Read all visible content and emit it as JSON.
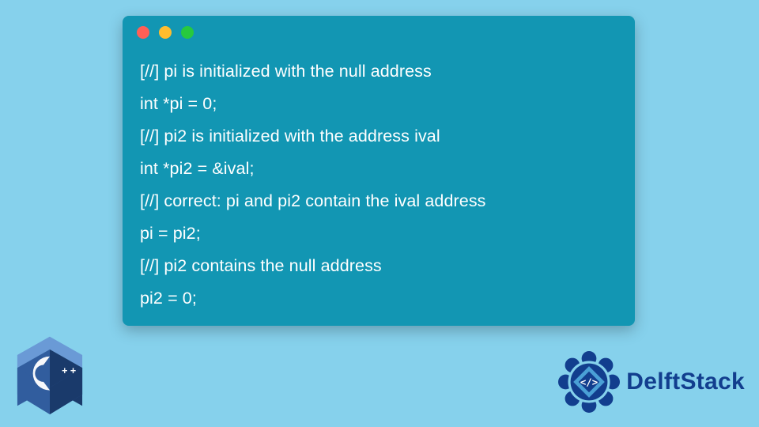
{
  "code": {
    "lines": [
      "[//] pi is initialized with the null address",
      "int *pi = 0;",
      "[//] pi2 is initialized with the address ival",
      "int *pi2 = &ival;",
      "[//] correct: pi and pi2 contain the ival address",
      "pi = pi2;",
      "[//] pi2 contains the null address",
      "pi2 = 0;"
    ]
  },
  "logos": {
    "cpp_label": "C++",
    "delftstack_text": "DelftStack"
  },
  "colors": {
    "page_bg": "#86d1ec",
    "window_bg": "#1296b3",
    "code_text": "#ffffff",
    "cpp_light": "#6a9ad6",
    "cpp_mid": "#315d9e",
    "cpp_dark": "#1a3a6b",
    "delft_primary": "#123e8e",
    "delft_accent": "#4aa0d6"
  }
}
